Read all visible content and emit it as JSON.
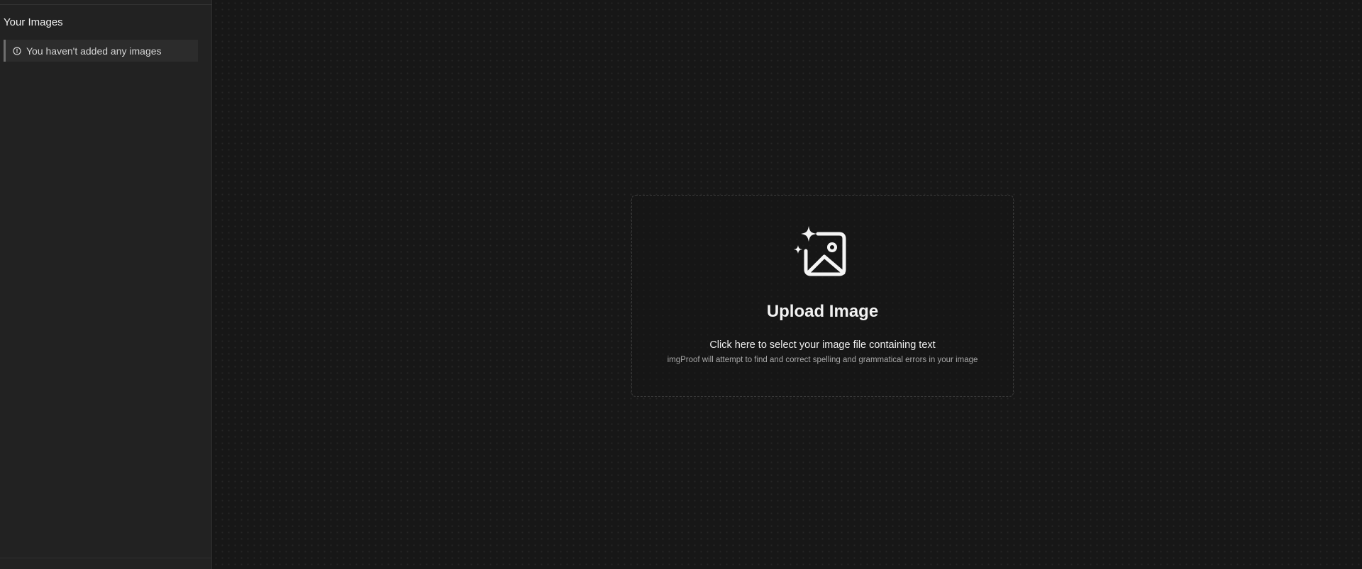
{
  "sidebar": {
    "title": "Your Images",
    "empty_message": "You haven't added any images",
    "empty_icon": "info-circle-icon"
  },
  "upload": {
    "icon": "image-sparkle-icon",
    "title": "Upload Image",
    "subtitle": "Click here to select your image file containing text",
    "hint": "imgProof will attempt to find and correct spelling and grammatical errors in your image"
  },
  "colors": {
    "sidebar_bg": "#222222",
    "main_bg": "#171717",
    "notice_bg": "#2c2c2c",
    "notice_accent": "#6e6e6e",
    "text_primary": "#f0f0f0",
    "text_muted": "#a8a8a8"
  }
}
